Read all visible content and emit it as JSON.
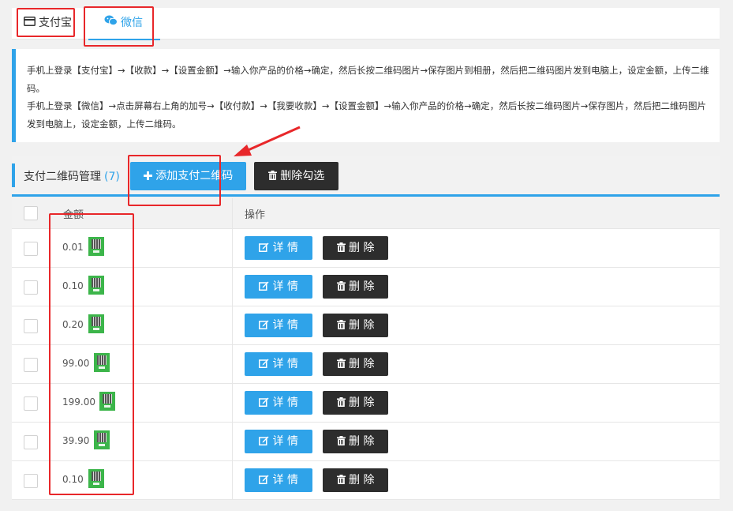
{
  "tabs": {
    "alipay": {
      "label": "支付宝",
      "icon": "credit-card-icon"
    },
    "wechat": {
      "label": "微信",
      "icon": "wechat-icon"
    }
  },
  "notice": {
    "line1": "手机上登录【支付宝】→【收款】→【设置金额】→输入你产品的价格→确定，然后长按二维码图片→保存图片到相册，然后把二维码图片发到电脑上，设定金额，上传二维码。",
    "line2": "手机上登录【微信】→点击屏幕右上角的加号→【收付款】→【我要收款】→【设置金额】→输入你产品的价格→确定，然后长按二维码图片→保存图片，然后把二维码图片发到电脑上，设定金额，上传二维码。"
  },
  "panel": {
    "title": "支付二维码管理",
    "count": "(7)",
    "add_button": "添加支付二维码",
    "delete_selected_button": "删除勾选"
  },
  "table": {
    "headers": {
      "amount": "金额",
      "operations": "操作"
    },
    "detail_label": "详 情",
    "delete_label": "删 除",
    "rows": [
      {
        "amount": "0.01"
      },
      {
        "amount": "0.10"
      },
      {
        "amount": "0.20"
      },
      {
        "amount": "99.00"
      },
      {
        "amount": "199.00"
      },
      {
        "amount": "39.90"
      },
      {
        "amount": "0.10"
      }
    ]
  },
  "colors": {
    "accent": "#2fa3e9",
    "dark_button": "#2d2d2d",
    "highlight": "#e8272a",
    "qr_green": "#3cb54a"
  }
}
